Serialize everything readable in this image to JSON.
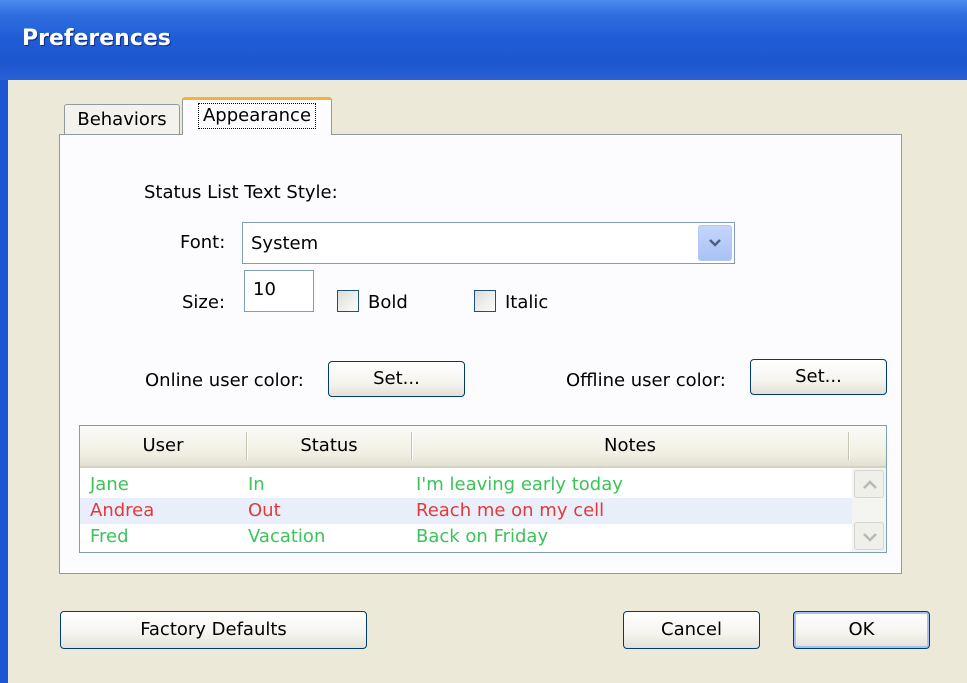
{
  "window": {
    "title": "Preferences"
  },
  "tabs": [
    {
      "label": "Behaviors",
      "selected": false
    },
    {
      "label": "Appearance",
      "selected": true
    }
  ],
  "appearance": {
    "section_label": "Status List Text Style:",
    "font_label": "Font:",
    "font_value": "System",
    "size_label": "Size:",
    "size_value": "10",
    "bold_label": "Bold",
    "bold_checked": false,
    "italic_label": "Italic",
    "italic_checked": false,
    "online_color_label": "Online user color:",
    "online_set_label": "Set...",
    "offline_color_label": "Offline user color:",
    "offline_set_label": "Set..."
  },
  "status_list": {
    "columns": [
      "User",
      "Status",
      "Notes"
    ],
    "rows": [
      {
        "user": "Jane",
        "status": "In",
        "notes": "I'm leaving early today",
        "color": "#3cc35a"
      },
      {
        "user": "Andrea",
        "status": "Out",
        "notes": "Reach me on my cell",
        "color": "#e23a3a",
        "selected": true
      },
      {
        "user": "Fred",
        "status": "Vacation",
        "notes": "Back on Friday",
        "color": "#3cc35a"
      }
    ],
    "selected_row_bg": "#e8eefa"
  },
  "buttons": {
    "factory_defaults": "Factory Defaults",
    "cancel": "Cancel",
    "ok": "OK"
  },
  "colors": {
    "titlebar": "#1d57cf",
    "dialog_bg": "#ece9d8",
    "online": "#3cc35a",
    "offline": "#e23a3a"
  }
}
